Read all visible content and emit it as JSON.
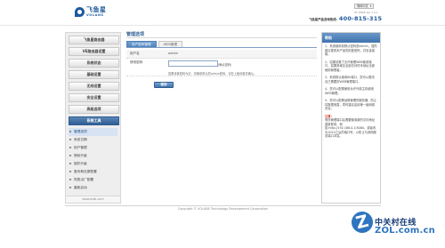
{
  "brand": {
    "logo_cn": "飞鱼星",
    "logo_en": "VOLANS"
  },
  "header": {
    "language": "简体中文",
    "version": "VF 2008 Ver 1 0 1",
    "hotline_label": "飞鱼星产品咨询热线:",
    "hotline_number": "400-815-315"
  },
  "sidebar": {
    "items": [
      {
        "label": "飞鱼星路由器",
        "active": false
      },
      {
        "label": "VE路由器设置",
        "active": false
      },
      {
        "label": "系统状态",
        "active": false
      },
      {
        "label": "基础设置",
        "active": false
      },
      {
        "label": "无线设置",
        "active": false
      },
      {
        "label": "安全设置",
        "active": false
      },
      {
        "label": "高级选项",
        "active": false
      },
      {
        "label": "系统工具",
        "active": true
      }
    ],
    "subitems": [
      {
        "label": "管理选项",
        "current": true
      },
      {
        "label": "系统日期",
        "current": false
      },
      {
        "label": "用户管理",
        "current": false
      },
      {
        "label": "授权升级",
        "current": false
      },
      {
        "label": "固件升级",
        "current": false
      },
      {
        "label": "备份和还原配置",
        "current": false
      },
      {
        "label": "恢复出厂配置",
        "current": false
      },
      {
        "label": "重新启动",
        "current": false
      }
    ],
    "url": "www.adsl.com"
  },
  "main": {
    "title": "管理选项",
    "tabs": [
      {
        "label": "用户密码管理",
        "active": true
      },
      {
        "label": "WEB管理",
        "active": false
      }
    ],
    "username_label": "用户名",
    "username_value": "admin",
    "password_label": "修改密码",
    "password_value": "",
    "password_note": "(确认密码)",
    "password_hint": "如果设置密码为空，将使用默认的admin密码，请在上面设置并确认。",
    "save_button": "保存"
  },
  "help": {
    "title": "帮助",
    "paragraphs": [
      "1、系统使用前默认密码是admin，强烈建议更改本产品的前登密码，并妥善保管。",
      "2、如果设置了允许管理WEB使用端口，如果其域名全部访问时本地址全部使用管理者。",
      "3、系统默认使用80端口，您可以更改自己需要的WEB管理端口。",
      "4、您可以配置使用允许外部主机使用WEB管理。",
      "5、您可以配置远程管理的服务器，防止将数据泄露，同时建议启用第一级网络安全。"
    ],
    "warning_title": "注意:",
    "warning_text": "修改管理端口后需要使用新的访问地址重新登录，例如:http://192.168.0.1:8080，或者改为1024之后的端口号，以防止与其他服务端口冲突。"
  },
  "footer": {
    "text": "Copyright © VOLANS Technology Development Corporation"
  },
  "watermark": {
    "cn": "中关村在线",
    "en": "ZOL.com.cn"
  }
}
